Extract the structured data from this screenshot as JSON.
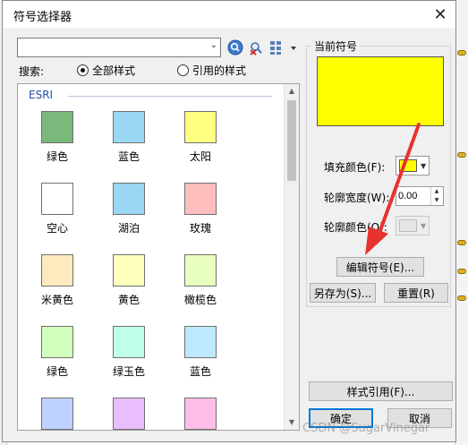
{
  "dialog": {
    "title": "符号选择器"
  },
  "search": {
    "input_value": "",
    "label": "搜索:"
  },
  "filters": {
    "all_styles": "全部样式",
    "referenced_styles": "引用的样式",
    "selected": "all_styles"
  },
  "symbols": {
    "group_name": "ESRI",
    "items": [
      {
        "label": "绿色",
        "color": "#7ab87c"
      },
      {
        "label": "蓝色",
        "color": "#99d7f2"
      },
      {
        "label": "太阳",
        "color": "#ffff80"
      },
      {
        "label": "空心",
        "color": "#ffffff"
      },
      {
        "label": "湖泊",
        "color": "#99d7f2"
      },
      {
        "label": "玫瑰",
        "color": "#ffbebe"
      },
      {
        "label": "米黄色",
        "color": "#ffe9be"
      },
      {
        "label": "黄色",
        "color": "#ffffbe"
      },
      {
        "label": "橄榄色",
        "color": "#e9ffbe"
      },
      {
        "label": "绿色",
        "color": "#d3ffbe"
      },
      {
        "label": "绿玉色",
        "color": "#beffe8"
      },
      {
        "label": "蓝色",
        "color": "#bee8ff"
      },
      {
        "label": "",
        "color": "#bed2ff"
      },
      {
        "label": "",
        "color": "#e8beff"
      },
      {
        "label": "",
        "color": "#ffbee8"
      }
    ]
  },
  "current_symbol": {
    "title": "当前符号",
    "preview_color": "#ffff00",
    "fill_color_label": "填充颜色(F):",
    "fill_color": "#ffff00",
    "outline_width_label": "轮廓宽度(W):",
    "outline_width": "0.00",
    "outline_color_label": "轮廓颜色(O):"
  },
  "buttons": {
    "edit_symbol": "编辑符号(E)...",
    "save_as": "另存为(S)...",
    "reset": "重置(R)",
    "style_references": "样式引用(F)...",
    "ok": "确定",
    "cancel": "取消"
  },
  "watermark": "CSDN @SugarVinegar",
  "colors": {
    "accent": "#0078d7",
    "arrow": "#e8322d",
    "group_header": "#1f4fa8"
  }
}
